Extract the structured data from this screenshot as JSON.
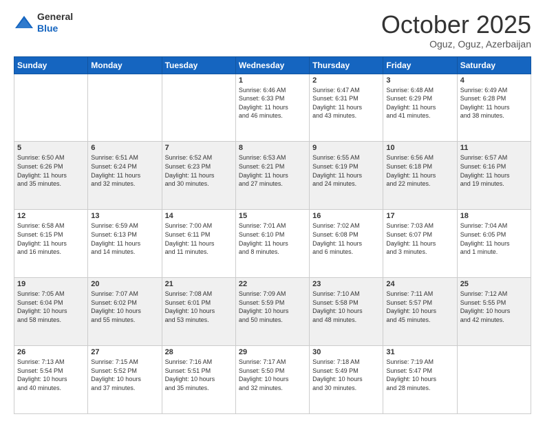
{
  "header": {
    "logo_line1": "General",
    "logo_line2": "Blue",
    "month": "October 2025",
    "location": "Oguz, Oguz, Azerbaijan"
  },
  "weekdays": [
    "Sunday",
    "Monday",
    "Tuesday",
    "Wednesday",
    "Thursday",
    "Friday",
    "Saturday"
  ],
  "weeks": [
    [
      {
        "day": "",
        "info": ""
      },
      {
        "day": "",
        "info": ""
      },
      {
        "day": "",
        "info": ""
      },
      {
        "day": "1",
        "info": "Sunrise: 6:46 AM\nSunset: 6:33 PM\nDaylight: 11 hours\nand 46 minutes."
      },
      {
        "day": "2",
        "info": "Sunrise: 6:47 AM\nSunset: 6:31 PM\nDaylight: 11 hours\nand 43 minutes."
      },
      {
        "day": "3",
        "info": "Sunrise: 6:48 AM\nSunset: 6:29 PM\nDaylight: 11 hours\nand 41 minutes."
      },
      {
        "day": "4",
        "info": "Sunrise: 6:49 AM\nSunset: 6:28 PM\nDaylight: 11 hours\nand 38 minutes."
      }
    ],
    [
      {
        "day": "5",
        "info": "Sunrise: 6:50 AM\nSunset: 6:26 PM\nDaylight: 11 hours\nand 35 minutes."
      },
      {
        "day": "6",
        "info": "Sunrise: 6:51 AM\nSunset: 6:24 PM\nDaylight: 11 hours\nand 32 minutes."
      },
      {
        "day": "7",
        "info": "Sunrise: 6:52 AM\nSunset: 6:23 PM\nDaylight: 11 hours\nand 30 minutes."
      },
      {
        "day": "8",
        "info": "Sunrise: 6:53 AM\nSunset: 6:21 PM\nDaylight: 11 hours\nand 27 minutes."
      },
      {
        "day": "9",
        "info": "Sunrise: 6:55 AM\nSunset: 6:19 PM\nDaylight: 11 hours\nand 24 minutes."
      },
      {
        "day": "10",
        "info": "Sunrise: 6:56 AM\nSunset: 6:18 PM\nDaylight: 11 hours\nand 22 minutes."
      },
      {
        "day": "11",
        "info": "Sunrise: 6:57 AM\nSunset: 6:16 PM\nDaylight: 11 hours\nand 19 minutes."
      }
    ],
    [
      {
        "day": "12",
        "info": "Sunrise: 6:58 AM\nSunset: 6:15 PM\nDaylight: 11 hours\nand 16 minutes."
      },
      {
        "day": "13",
        "info": "Sunrise: 6:59 AM\nSunset: 6:13 PM\nDaylight: 11 hours\nand 14 minutes."
      },
      {
        "day": "14",
        "info": "Sunrise: 7:00 AM\nSunset: 6:11 PM\nDaylight: 11 hours\nand 11 minutes."
      },
      {
        "day": "15",
        "info": "Sunrise: 7:01 AM\nSunset: 6:10 PM\nDaylight: 11 hours\nand 8 minutes."
      },
      {
        "day": "16",
        "info": "Sunrise: 7:02 AM\nSunset: 6:08 PM\nDaylight: 11 hours\nand 6 minutes."
      },
      {
        "day": "17",
        "info": "Sunrise: 7:03 AM\nSunset: 6:07 PM\nDaylight: 11 hours\nand 3 minutes."
      },
      {
        "day": "18",
        "info": "Sunrise: 7:04 AM\nSunset: 6:05 PM\nDaylight: 11 hours\nand 1 minute."
      }
    ],
    [
      {
        "day": "19",
        "info": "Sunrise: 7:05 AM\nSunset: 6:04 PM\nDaylight: 10 hours\nand 58 minutes."
      },
      {
        "day": "20",
        "info": "Sunrise: 7:07 AM\nSunset: 6:02 PM\nDaylight: 10 hours\nand 55 minutes."
      },
      {
        "day": "21",
        "info": "Sunrise: 7:08 AM\nSunset: 6:01 PM\nDaylight: 10 hours\nand 53 minutes."
      },
      {
        "day": "22",
        "info": "Sunrise: 7:09 AM\nSunset: 5:59 PM\nDaylight: 10 hours\nand 50 minutes."
      },
      {
        "day": "23",
        "info": "Sunrise: 7:10 AM\nSunset: 5:58 PM\nDaylight: 10 hours\nand 48 minutes."
      },
      {
        "day": "24",
        "info": "Sunrise: 7:11 AM\nSunset: 5:57 PM\nDaylight: 10 hours\nand 45 minutes."
      },
      {
        "day": "25",
        "info": "Sunrise: 7:12 AM\nSunset: 5:55 PM\nDaylight: 10 hours\nand 42 minutes."
      }
    ],
    [
      {
        "day": "26",
        "info": "Sunrise: 7:13 AM\nSunset: 5:54 PM\nDaylight: 10 hours\nand 40 minutes."
      },
      {
        "day": "27",
        "info": "Sunrise: 7:15 AM\nSunset: 5:52 PM\nDaylight: 10 hours\nand 37 minutes."
      },
      {
        "day": "28",
        "info": "Sunrise: 7:16 AM\nSunset: 5:51 PM\nDaylight: 10 hours\nand 35 minutes."
      },
      {
        "day": "29",
        "info": "Sunrise: 7:17 AM\nSunset: 5:50 PM\nDaylight: 10 hours\nand 32 minutes."
      },
      {
        "day": "30",
        "info": "Sunrise: 7:18 AM\nSunset: 5:49 PM\nDaylight: 10 hours\nand 30 minutes."
      },
      {
        "day": "31",
        "info": "Sunrise: 7:19 AM\nSunset: 5:47 PM\nDaylight: 10 hours\nand 28 minutes."
      },
      {
        "day": "",
        "info": ""
      }
    ]
  ]
}
